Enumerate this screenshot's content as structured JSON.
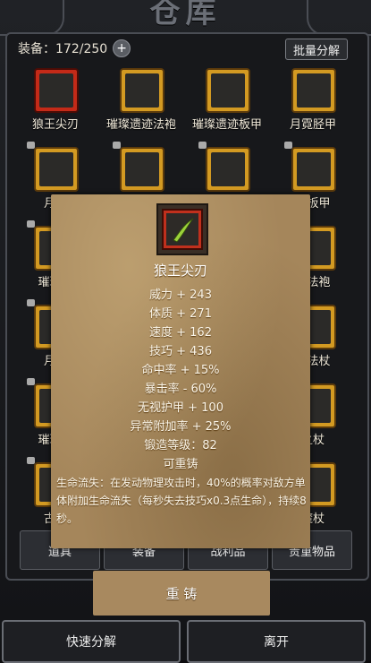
{
  "window": {
    "title": "仓库"
  },
  "header": {
    "capacity_label": "装备：172/250",
    "plus_symbol": "+",
    "bulk_button": "批量分解"
  },
  "grid_items": [
    {
      "name": "狼王尖刃",
      "frame": "red",
      "locked": false
    },
    {
      "name": "璀璨遗迹法袍",
      "frame": "gold",
      "locked": false
    },
    {
      "name": "璀璨遗迹板甲",
      "frame": "gold",
      "locked": false
    },
    {
      "name": "月霓胫甲",
      "frame": "gold",
      "locked": false
    },
    {
      "name": "月霓",
      "frame": "gold",
      "locked": true
    },
    {
      "name": "",
      "frame": "gold",
      "locked": true
    },
    {
      "name": "",
      "frame": "gold",
      "locked": true
    },
    {
      "name": "迹板甲",
      "frame": "gold",
      "locked": true
    },
    {
      "name": "璀璨遗",
      "frame": "gold",
      "locked": true
    },
    {
      "name": "",
      "frame": "gold",
      "locked": false
    },
    {
      "name": "",
      "frame": "gold",
      "locked": false
    },
    {
      "name": "迹法袍",
      "frame": "gold",
      "locked": false
    },
    {
      "name": "月霓",
      "frame": "gold",
      "locked": true
    },
    {
      "name": "",
      "frame": "gold",
      "locked": false
    },
    {
      "name": "",
      "frame": "gold",
      "locked": false
    },
    {
      "name": "迹法杖",
      "frame": "gold",
      "locked": false
    },
    {
      "name": "璀璨遗",
      "frame": "gold",
      "locked": true
    },
    {
      "name": "",
      "frame": "gold",
      "locked": false
    },
    {
      "name": "",
      "frame": "gold",
      "locked": false
    },
    {
      "name": "之杖",
      "frame": "gold",
      "locked": false
    },
    {
      "name": "古猎",
      "frame": "gold",
      "locked": true
    },
    {
      "name": "",
      "frame": "gold",
      "locked": false
    },
    {
      "name": "",
      "frame": "gold",
      "locked": false
    },
    {
      "name": "魔杖",
      "frame": "gold",
      "locked": false
    }
  ],
  "tabs": [
    {
      "label": "道具"
    },
    {
      "label": "装备"
    },
    {
      "label": "战利品"
    },
    {
      "label": "贵重物品"
    }
  ],
  "tooltip": {
    "title": "狼王尖刃",
    "stats": [
      "威力 + 243",
      "体质 + 271",
      "速度 + 162",
      "技巧 + 436",
      "命中率 + 15%",
      "暴击率 - 60%",
      "无视护甲 + 100",
      "异常附加率 + 25%",
      "锻造等级：82",
      "可重铸"
    ],
    "description": "生命流失：在发动物理攻击时，40%的概率对敌方单体附加生命流失（每秒失去技巧x0.3点生命），持续8秒。"
  },
  "reforge_button": "重 铸",
  "bottom": {
    "quick_disassemble": "快速分解",
    "leave": "离开"
  },
  "colors": {
    "gold_frame": "#d39a22",
    "red_frame": "#c42a18",
    "parchment": "#a5865b"
  }
}
